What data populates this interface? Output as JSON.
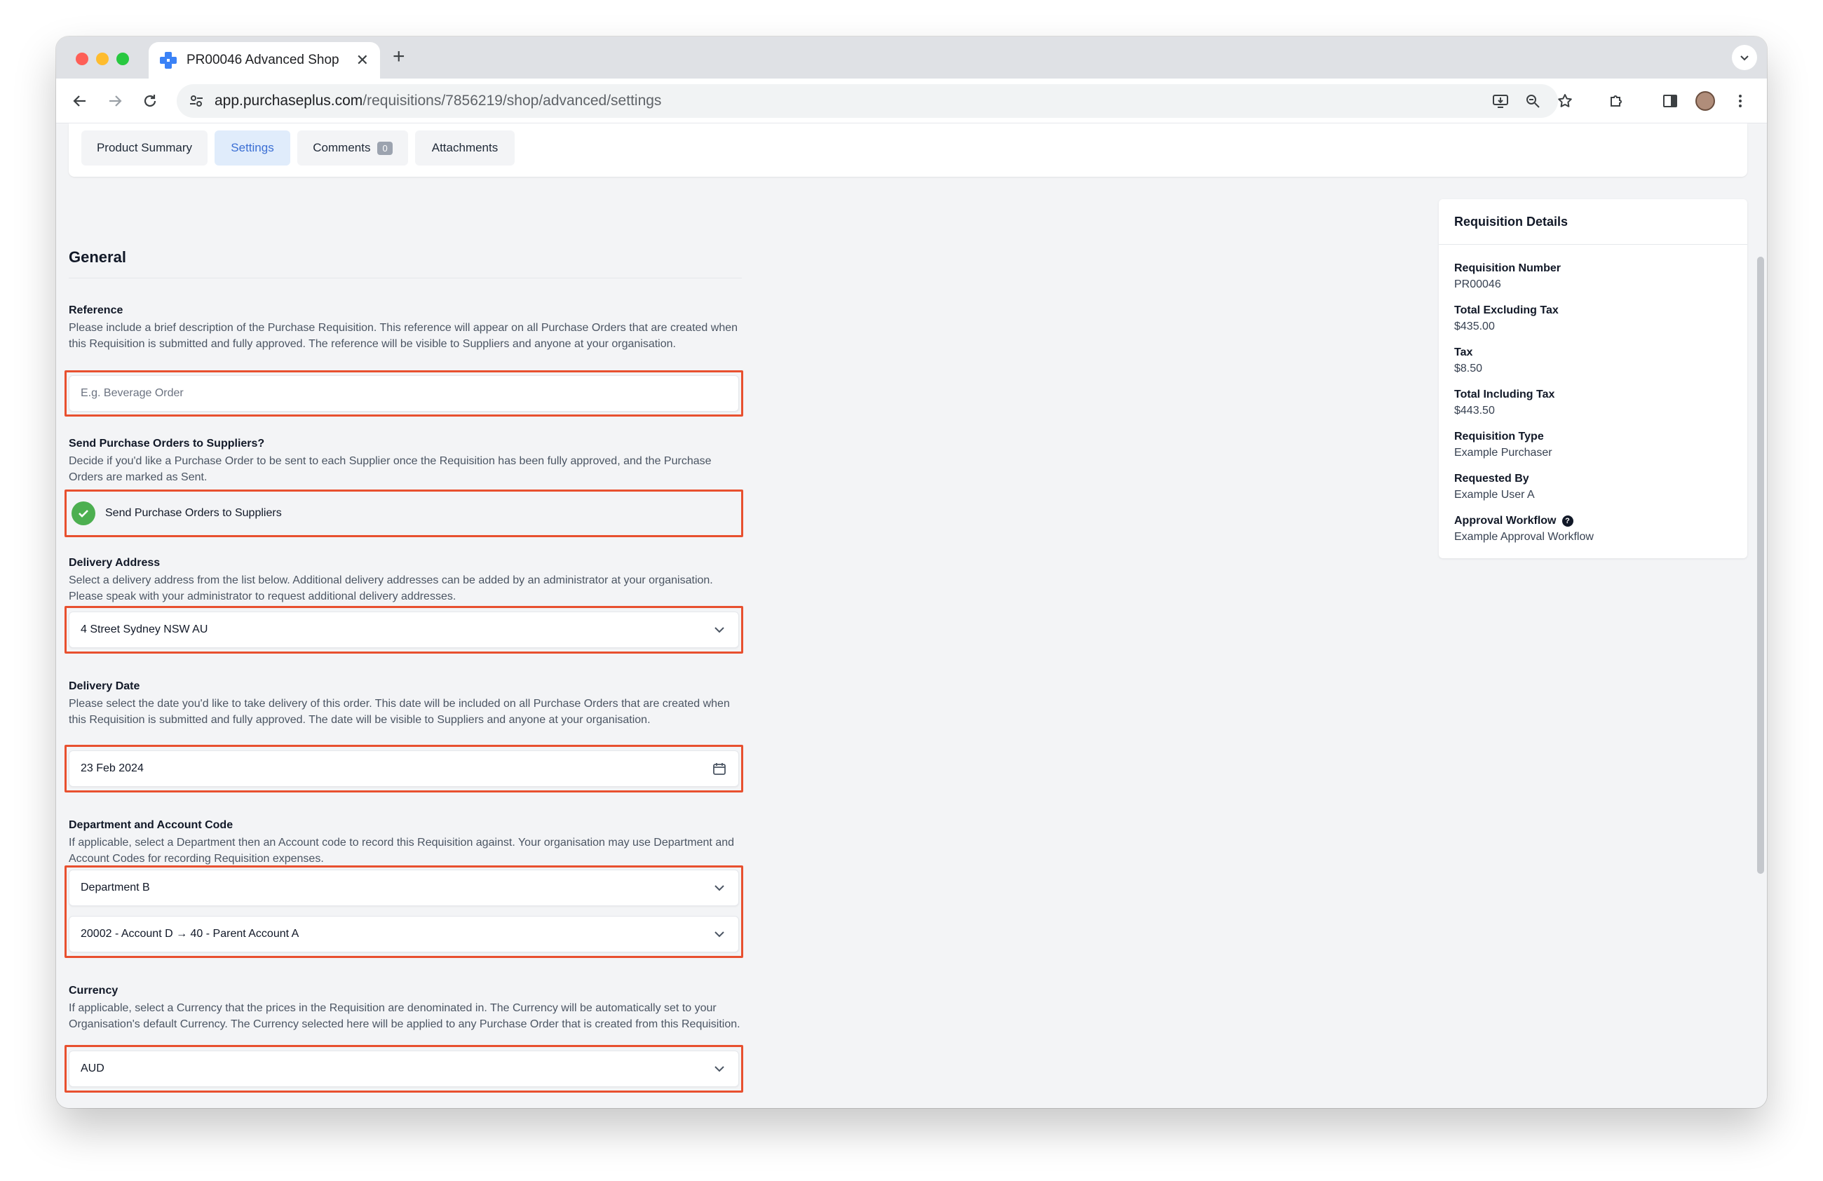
{
  "browser": {
    "tab_title": "PR00046 Advanced Shop",
    "new_tab": "+",
    "tab_close": "✕",
    "url_host": "app.purchaseplus.com",
    "url_path": "/requisitions/7856219/shop/advanced/settings"
  },
  "page_tabs": [
    {
      "label": "Product Summary"
    },
    {
      "label": "Settings",
      "active": true
    },
    {
      "label": "Comments",
      "badge": "0"
    },
    {
      "label": "Attachments"
    }
  ],
  "general": {
    "title": "General",
    "reference": {
      "label": "Reference",
      "description": "Please include a brief description of the Purchase Requisition. This reference will appear on all Purchase Orders that are created when this Requisition is submitted and fully approved. The reference will be visible to Suppliers and anyone at your organisation.",
      "placeholder": "E.g. Beverage Order"
    },
    "send_po": {
      "label": "Send Purchase Orders to Suppliers?",
      "description": "Decide if you'd like a Purchase Order to be sent to each Supplier once the Requisition has been fully approved, and the Purchase Orders are marked as Sent.",
      "option_label": "Send Purchase Orders to Suppliers"
    },
    "delivery_address": {
      "label": "Delivery Address",
      "description": "Select a delivery address from the list below. Additional delivery addresses can be added by an administrator at your organisation. Please speak with your administrator to request additional delivery addresses.",
      "value": "4 Street  Sydney NSW AU"
    },
    "delivery_date": {
      "label": "Delivery Date",
      "description": "Please select the date you'd like to take delivery of this order. This date will be included on all Purchase Orders that are created when this Requisition is submitted and fully approved. The date will be visible to Suppliers and anyone at your organisation.",
      "value": "23 Feb 2024"
    },
    "department": {
      "label": "Department and Account Code",
      "description": "If applicable, select a Department then an Account code to record this Requisition against. Your organisation may use Department and Account Codes for recording Requisition expenses.",
      "department_value": "Department B",
      "account_value": "20002 - Account D → 40 - Parent Account A"
    },
    "currency": {
      "label": "Currency",
      "description": "If applicable, select a Currency that the prices in the Requisition are denominated in. The Currency will be automatically set to your Organisation's default Currency. The Currency selected here will be applied to any Purchase Order that is created from this Requisition.",
      "value": "AUD"
    }
  },
  "requisition_details": {
    "title": "Requisition Details",
    "items": [
      {
        "label": "Requisition Number",
        "value": "PR00046"
      },
      {
        "label": "Total Excluding Tax",
        "value": "$435.00"
      },
      {
        "label": "Tax",
        "value": "$8.50"
      },
      {
        "label": "Total Including Tax",
        "value": "$443.50"
      },
      {
        "label": "Requisition Type",
        "value": "Example Purchaser"
      },
      {
        "label": "Requested By",
        "value": "Example User A"
      },
      {
        "label": "Approval Workflow",
        "value": "Example Approval Workflow",
        "help_icon": "?"
      }
    ]
  },
  "colors": {
    "highlight": "#e8502f",
    "accent": "#3b6fd4",
    "check": "#4caf50"
  }
}
